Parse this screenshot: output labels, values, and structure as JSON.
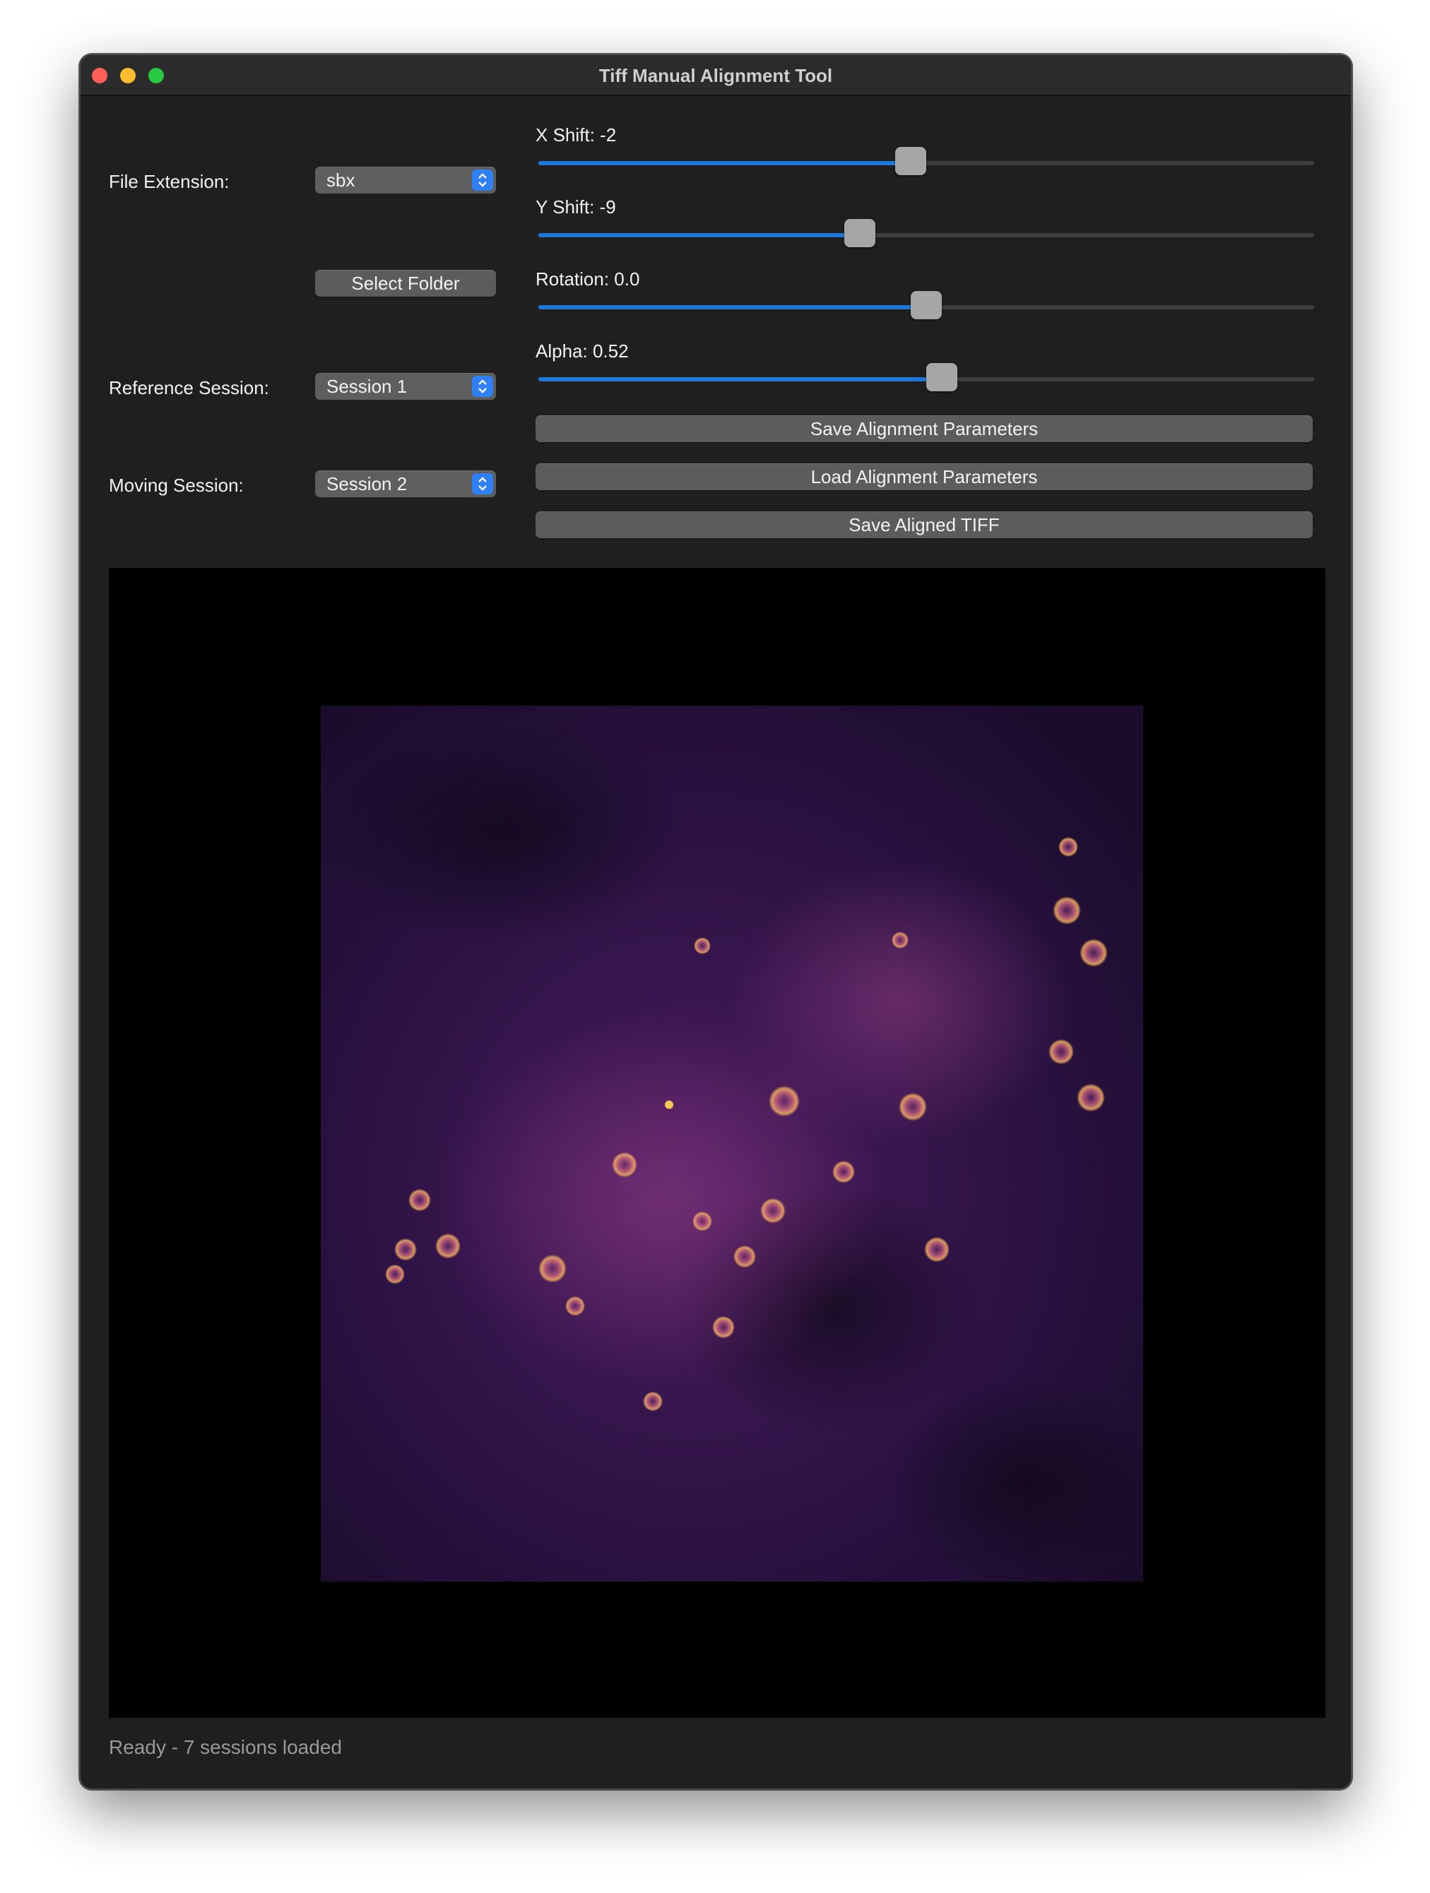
{
  "window": {
    "title": "Tiff Manual Alignment Tool"
  },
  "controls": {
    "file_extension": {
      "label": "File Extension:",
      "value": "sbx"
    },
    "select_folder": "Select Folder",
    "reference_session": {
      "label": "Reference Session:",
      "value": "Session 1"
    },
    "moving_session": {
      "label": "Moving Session:",
      "value": "Session 2"
    }
  },
  "sliders": {
    "x_shift": {
      "label": "X Shift: -2",
      "fraction": 0.48
    },
    "y_shift": {
      "label": "Y Shift: -9",
      "fraction": 0.414
    },
    "rotation": {
      "label": "Rotation: 0.0",
      "fraction": 0.5
    },
    "alpha": {
      "label": "Alpha: 0.52",
      "fraction": 0.52
    }
  },
  "buttons": {
    "save_params": "Save Alignment Parameters",
    "load_params": "Load Alignment Parameters",
    "save_tiff": "Save Aligned TIFF"
  },
  "image": {
    "description_icon": "microscopy-image",
    "colormap": [
      "#0a0510",
      "#3b1456",
      "#7a2d7e",
      "#c2607a",
      "#f6b35a"
    ]
  },
  "status": {
    "text": "Ready - 7 sessions loaded"
  }
}
